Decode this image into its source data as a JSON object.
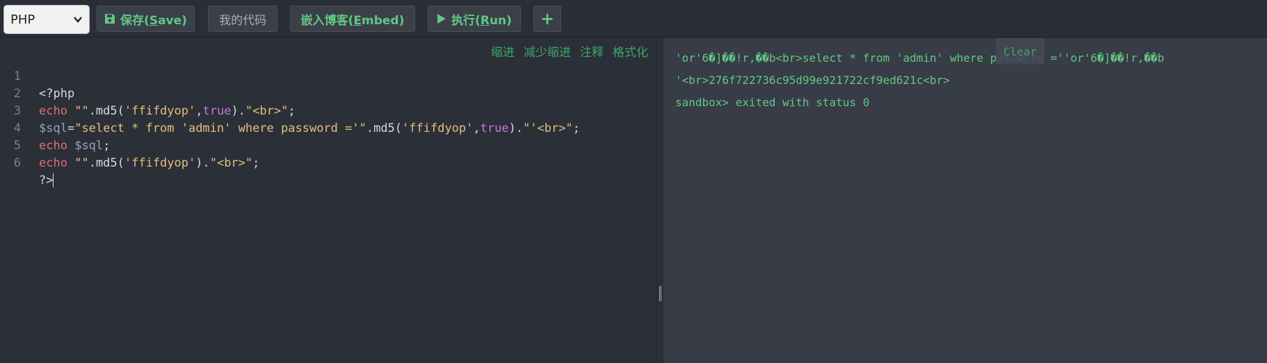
{
  "toolbar": {
    "language": "PHP",
    "save_prefix": "保存(",
    "save_key": "S",
    "save_suffix": "ave)",
    "my_code": "我的代码",
    "embed_prefix": "嵌入博客(",
    "embed_key": "E",
    "embed_suffix": "mbed)",
    "run_prefix": "执行(",
    "run_key": "R",
    "run_suffix": "un)",
    "add": "+"
  },
  "editor": {
    "tools": [
      "缩进",
      "减少缩进",
      "注释",
      "格式化"
    ],
    "line_numbers": [
      "1",
      "2",
      "3",
      "4",
      "5",
      "6"
    ],
    "lines": {
      "l1": "<?php",
      "l2_kw": "echo",
      "l2_s1": "\"\"",
      "l2_fn": ".md5(",
      "l2_s2": "'ffifdyop'",
      "l2_comma": ",",
      "l2_bool": "true",
      "l2_close": ").",
      "l2_s3": "\"<br>\"",
      "l2_end": ";",
      "l3_var": "$sql",
      "l3_eq": "=",
      "l3_s1": "\"select * from 'admin' where password ='\"",
      "l3_fn": ".md5(",
      "l3_s2": "'ffifdyop'",
      "l3_comma": ",",
      "l3_bool": "true",
      "l3_close": ").",
      "l3_s3": "\"'<br>\"",
      "l3_end": ";",
      "l4_kw": "echo",
      "l4_var": "$sql",
      "l4_end": ";",
      "l5_kw": "echo",
      "l5_s1": "\"\"",
      "l5_fn": ".md5(",
      "l5_s2": "'ffifdyop'",
      "l5_close": ").",
      "l5_s3": "\"<br>\"",
      "l5_end": ";",
      "l6": "?>"
    }
  },
  "output": {
    "clear": "Clear",
    "lines": [
      "'or'6�]��!r,��b<br>select * from 'admin' where password =''or'6�]��!r,��b",
      "'<br>276f722736c95d99e921722cf9ed621c<br>",
      "sandbox> exited with status 0"
    ]
  }
}
